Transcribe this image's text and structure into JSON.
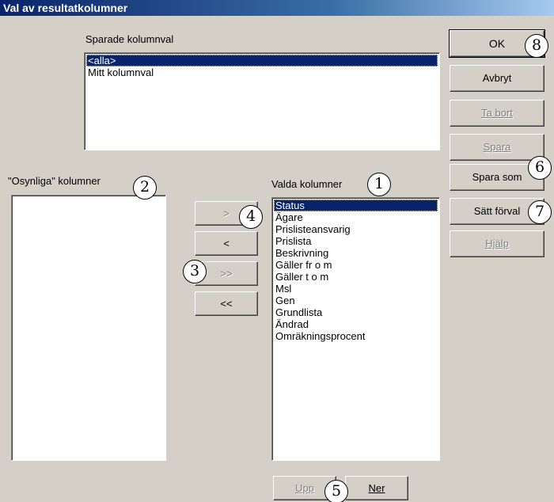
{
  "window": {
    "title": "Val av resultatkolumner"
  },
  "saved_columns": {
    "label": "Sparade kolumnval",
    "items": [
      {
        "label": "<alla>",
        "selected": true
      },
      {
        "label": "Mitt kolumnval",
        "selected": false
      }
    ]
  },
  "hidden_columns": {
    "label": "\"Osynliga\" kolumner",
    "items": []
  },
  "selected_columns": {
    "label": "Valda kolumner",
    "items": [
      {
        "label": "Status",
        "selected": true
      },
      {
        "label": "Ägare",
        "selected": false
      },
      {
        "label": "Prislisteansvarig",
        "selected": false
      },
      {
        "label": "Prislista",
        "selected": false
      },
      {
        "label": "Beskrivning",
        "selected": false
      },
      {
        "label": "Gäller fr o m",
        "selected": false
      },
      {
        "label": "Gäller t o m",
        "selected": false
      },
      {
        "label": "Msl",
        "selected": false
      },
      {
        "label": "Gen",
        "selected": false
      },
      {
        "label": "Grundlista",
        "selected": false
      },
      {
        "label": "Ändrad",
        "selected": false
      },
      {
        "label": "Omräkningsprocent",
        "selected": false
      }
    ]
  },
  "transfer_buttons": {
    "add_one": ">",
    "remove_one": "<",
    "add_all": ">>",
    "remove_all": "<<"
  },
  "order_buttons": {
    "up": "Upp",
    "down": "Ner"
  },
  "action_buttons": {
    "ok": "OK",
    "cancel": "Avbryt",
    "delete": "Ta bort",
    "save": "Spara",
    "save_as": "Spara som",
    "set_default": "Sätt förval",
    "help": "Hjälp"
  },
  "callouts": {
    "c1": "1",
    "c2": "2",
    "c3": "3",
    "c4": "4",
    "c5": "5",
    "c6": "6",
    "c7": "7",
    "c8": "8"
  }
}
